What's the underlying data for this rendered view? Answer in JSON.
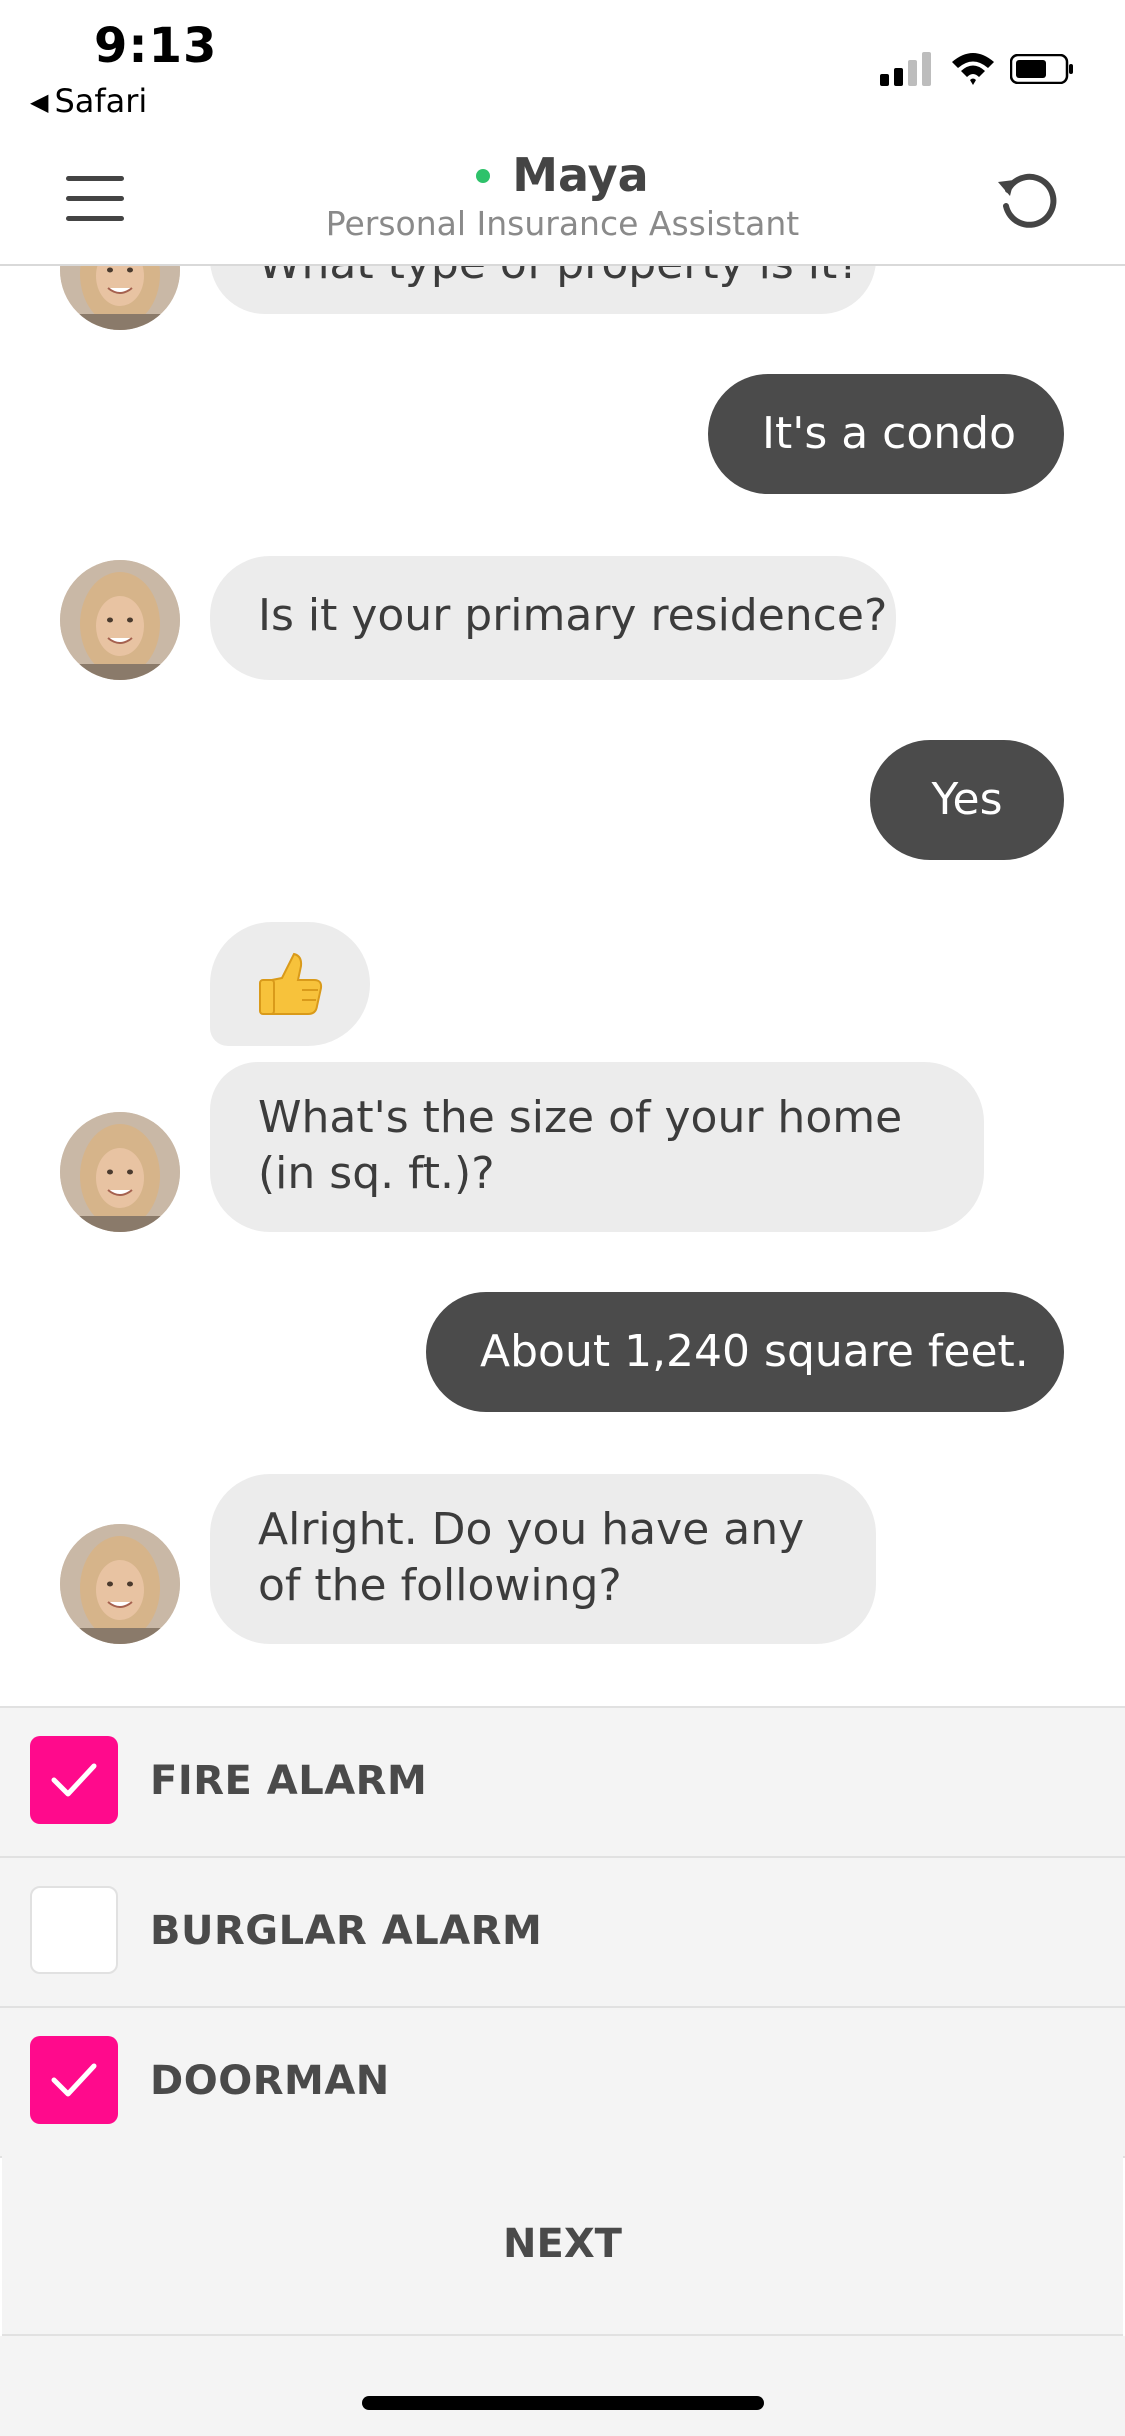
{
  "status_bar": {
    "time": "9:13",
    "back_app": "Safari"
  },
  "header": {
    "name": "Maya",
    "subtitle": "Personal Insurance Assistant",
    "online_color": "#2ec26a"
  },
  "messages": [
    {
      "sender": "bot",
      "text": "What type of property is it?",
      "partially_hidden": true
    },
    {
      "sender": "user",
      "text": "It's a condo"
    },
    {
      "sender": "bot",
      "text": "Is it your primary residence?"
    },
    {
      "sender": "user",
      "text": "Yes"
    },
    {
      "sender": "bot",
      "emoji": "👍"
    },
    {
      "sender": "bot",
      "text": "What's the size of your home (in sq. ft.)?"
    },
    {
      "sender": "user",
      "text": "About 1,240 square feet."
    },
    {
      "sender": "bot",
      "text": "Alright. Do you have any of the following?"
    }
  ],
  "options": [
    {
      "label": "FIRE ALARM",
      "checked": true
    },
    {
      "label": "BURGLAR ALARM",
      "checked": false
    },
    {
      "label": "DOORMAN",
      "checked": true
    }
  ],
  "next_label": "NEXT",
  "colors": {
    "accent": "#ff0a8c",
    "user_bubble": "#4b4b4b",
    "bot_bubble": "#ececec"
  },
  "icons": {
    "menu": "hamburger-icon",
    "restart": "restart-icon",
    "check": "checkmark-icon"
  }
}
